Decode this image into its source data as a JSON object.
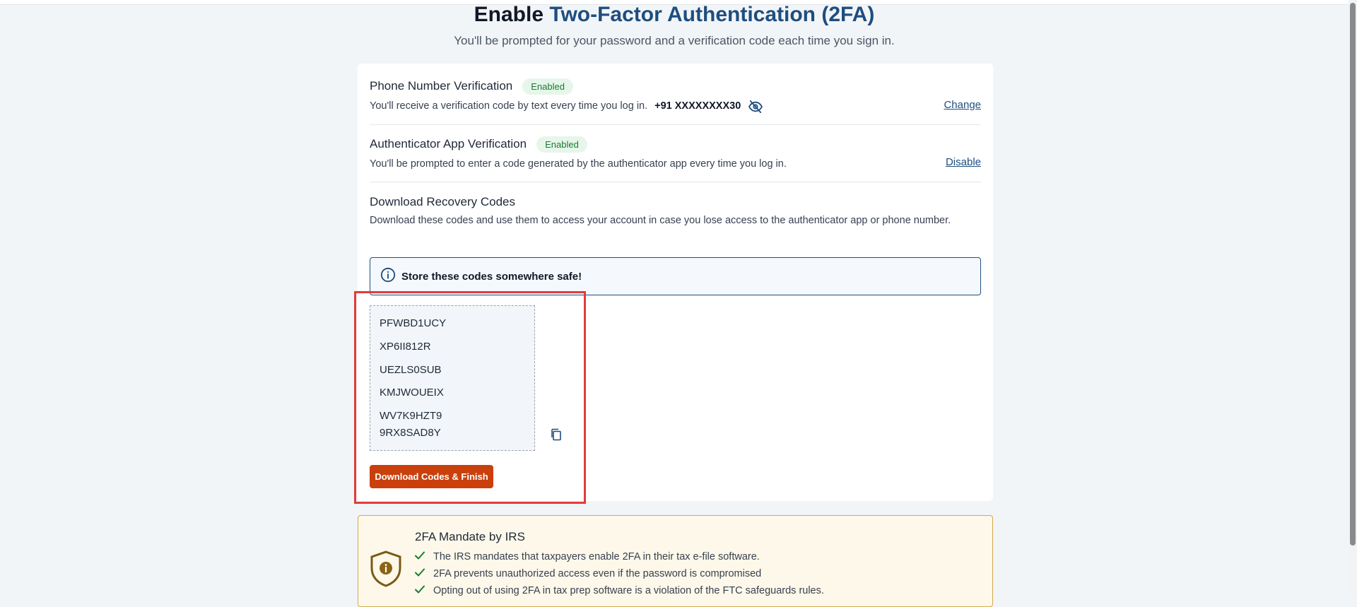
{
  "header": {
    "title_prefix": "Enable",
    "title_accent": "Two-Factor Authentication (2FA)",
    "subtitle": "You'll be prompted for your password and a verification code each time you sign in."
  },
  "phone": {
    "title": "Phone Number Verification",
    "badge": "Enabled",
    "description": "You'll receive a verification code by text every time you log in.",
    "number": "+91 XXXXXXXX30",
    "action": "Change"
  },
  "authenticator": {
    "title": "Authenticator App Verification",
    "badge": "Enabled",
    "description": "You'll be prompted to enter a code generated by the authenticator app every time you log in.",
    "action": "Disable"
  },
  "recovery": {
    "title": "Download Recovery Codes",
    "description": "Download these codes and use them to access your account in case you lose access to the authenticator app or phone number.",
    "alert": "Store these codes somewhere safe!",
    "codes": [
      "PFWBD1UCY",
      "XP6II812R",
      "UEZLS0SUB",
      "KMJWOUEIX",
      "WV7K9HZT9",
      "9RX8SAD8Y"
    ],
    "button": "Download Codes & Finish"
  },
  "mandate": {
    "title": "2FA Mandate by IRS",
    "items": [
      "The IRS mandates that taxpayers enable 2FA in their tax e-file software.",
      "2FA prevents unauthorized access even if the password is compromised",
      "Opting out of using 2FA in tax prep software is a violation of the FTC safeguards rules."
    ]
  },
  "colors": {
    "accent": "#1e4e7e",
    "primary_button": "#c9400c",
    "badge_bg": "#e6f6ea",
    "badge_text": "#1b7a35",
    "highlight": "#e23b3b",
    "mandate_bg": "#fdf8e9"
  },
  "icons": [
    "eye-off-icon",
    "info-icon",
    "copy-icon",
    "shield-info-icon",
    "check-icon"
  ]
}
